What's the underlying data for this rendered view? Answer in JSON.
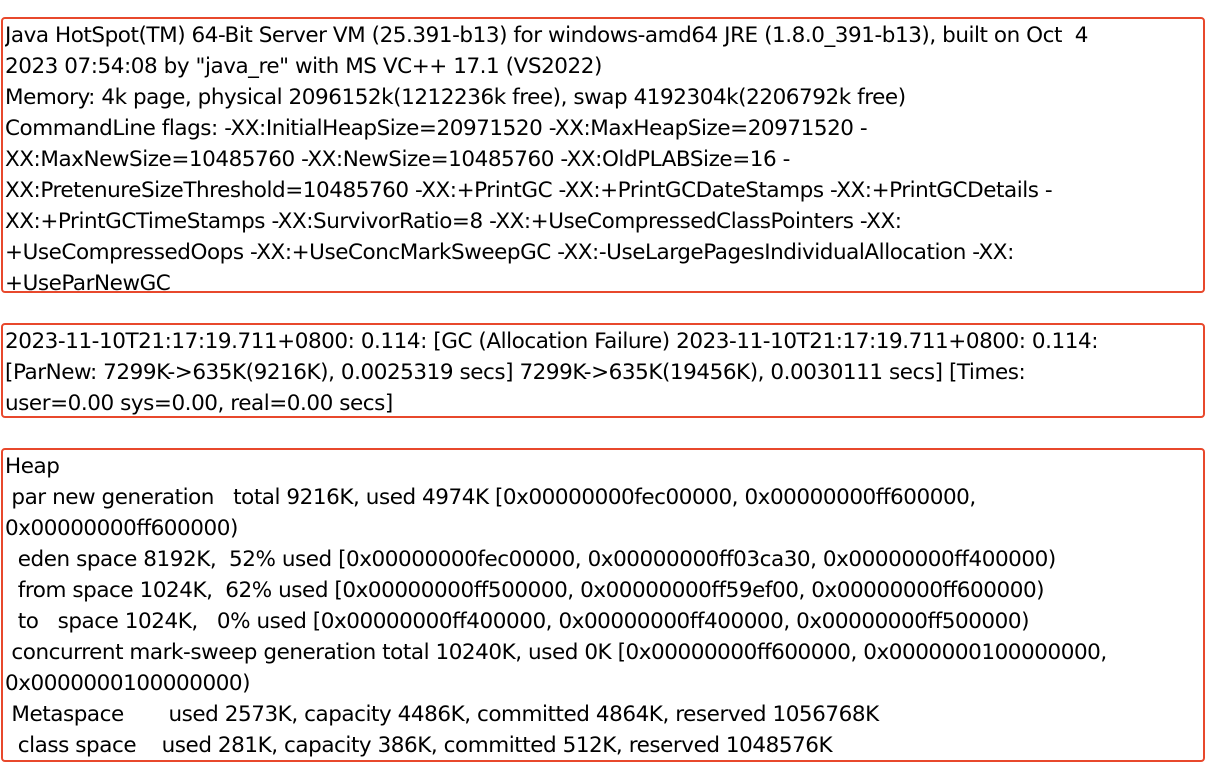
{
  "theme": {
    "border_color": "#e8482c",
    "background": "#ffffff",
    "text_color": "#000000"
  },
  "jvm_info": {
    "lines": [
      "Java HotSpot(TM) 64-Bit Server VM (25.391-b13) for windows-amd64 JRE (1.8.0_391-b13), built on Oct  4",
      "2023 07:54:08 by \"java_re\" with MS VC++ 17.1 (VS2022)",
      "Memory: 4k page, physical 2096152k(1212236k free), swap 4192304k(2206792k free)",
      "CommandLine flags: -XX:InitialHeapSize=20971520 -XX:MaxHeapSize=20971520 -",
      "XX:MaxNewSize=10485760 -XX:NewSize=10485760 -XX:OldPLABSize=16 -",
      "XX:PretenureSizeThreshold=10485760 -XX:+PrintGC -XX:+PrintGCDateStamps -XX:+PrintGCDetails -",
      "XX:+PrintGCTimeStamps -XX:SurvivorRatio=8 -XX:+UseCompressedClassPointers -XX:",
      "+UseCompressedOops -XX:+UseConcMarkSweepGC -XX:-UseLargePagesIndividualAllocation -XX:",
      "+UseParNewGC"
    ]
  },
  "gc_event": {
    "lines": [
      "2023-11-10T21:17:19.711+0800: 0.114: [GC (Allocation Failure) 2023-11-10T21:17:19.711+0800: 0.114:",
      "[ParNew: 7299K->635K(9216K), 0.0025319 secs] 7299K->635K(19456K), 0.0030111 secs] [Times:",
      "user=0.00 sys=0.00, real=0.00 secs]"
    ]
  },
  "heap_summary": {
    "lines": [
      "Heap",
      " par new generation   total 9216K, used 4974K [0x00000000fec00000, 0x00000000ff600000,",
      "0x00000000ff600000)",
      "  eden space 8192K,  52% used [0x00000000fec00000, 0x00000000ff03ca30, 0x00000000ff400000)",
      "  from space 1024K,  62% used [0x00000000ff500000, 0x00000000ff59ef00, 0x00000000ff600000)",
      "  to   space 1024K,   0% used [0x00000000ff400000, 0x00000000ff400000, 0x00000000ff500000)",
      " concurrent mark-sweep generation total 10240K, used 0K [0x00000000ff600000, 0x0000000100000000,",
      "0x0000000100000000)",
      " Metaspace       used 2573K, capacity 4486K, committed 4864K, reserved 1056768K",
      "  class space    used 281K, capacity 386K, committed 512K, reserved 1048576K"
    ]
  }
}
